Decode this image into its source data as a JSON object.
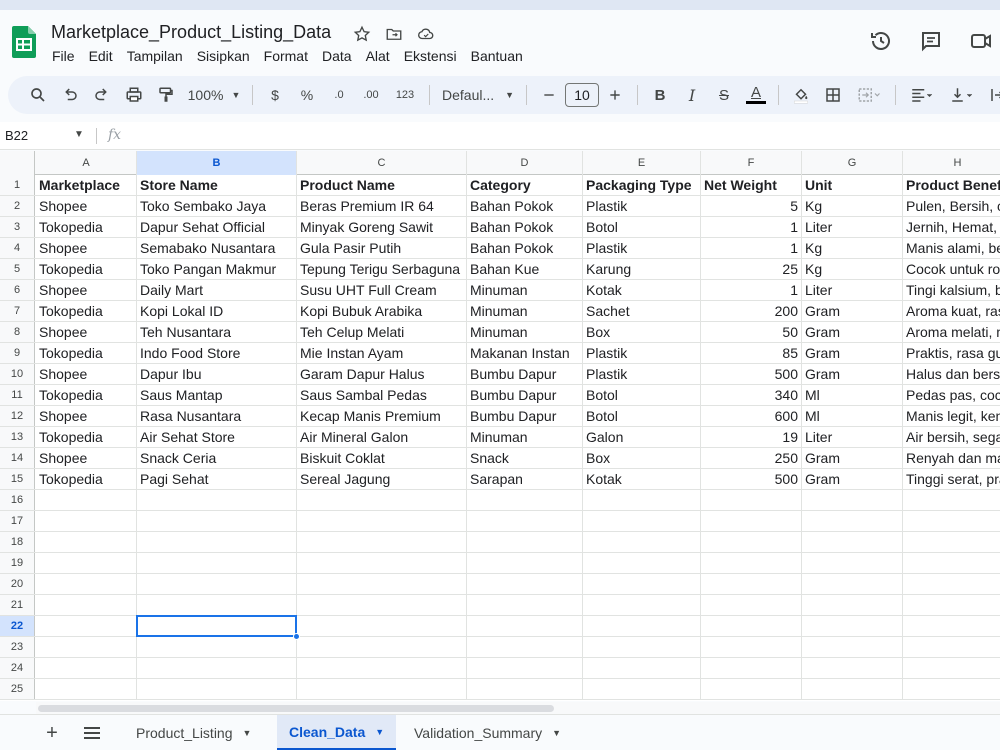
{
  "doc": {
    "title": "Marketplace_Product_Listing_Data"
  },
  "menu": [
    "File",
    "Edit",
    "Tampilan",
    "Sisipkan",
    "Format",
    "Data",
    "Alat",
    "Ekstensi",
    "Bantuan"
  ],
  "toolbar": {
    "zoom": "100%",
    "currency": "$",
    "percent": "%",
    "dec_decrease": ".0",
    "dec_increase": ".00",
    "format_123": "123",
    "font": "Defaul...",
    "font_size": "10",
    "bold": "B",
    "italic": "I",
    "strike": "S",
    "text_color": "A"
  },
  "formula_bar": {
    "cell_ref": "B22",
    "fx": "fx",
    "value": ""
  },
  "columns": [
    "A",
    "B",
    "C",
    "D",
    "E",
    "F",
    "G",
    "H"
  ],
  "selected": {
    "col": "B",
    "row": 22
  },
  "rows": [
    [
      "Marketplace",
      "Store Name",
      "Product Name",
      "Category",
      "Packaging Type",
      "Net Weight",
      "Unit",
      "Product Benefi"
    ],
    [
      "Shopee",
      "Toko Sembako Jaya",
      "Beras Premium IR 64",
      "Bahan Pokok",
      "Plastik",
      "5",
      "Kg",
      "Pulen, Bersih, c"
    ],
    [
      "Tokopedia",
      "Dapur Sehat Official",
      "Minyak Goreng Sawit",
      "Bahan Pokok",
      "Botol",
      "1",
      "Liter",
      "Jernih, Hemat, c"
    ],
    [
      "Shopee",
      "Semabako Nusantara",
      "Gula Pasir Putih",
      "Bahan Pokok",
      "Plastik",
      "1",
      "Kg",
      "Manis alami, be"
    ],
    [
      "Tokopedia",
      "Toko Pangan Makmur",
      "Tepung Terigu Serbaguna",
      "Bahan Kue",
      "Karung",
      "25",
      "Kg",
      "Cocok untuk rot"
    ],
    [
      "Shopee",
      "Daily Mart",
      "Susu UHT Full Cream",
      "Minuman",
      "Kotak",
      "1",
      "Liter",
      "Tingi kalsium, ba"
    ],
    [
      "Tokopedia",
      "Kopi Lokal ID",
      "Kopi Bubuk Arabika",
      "Minuman",
      "Sachet",
      "200",
      "Gram",
      "Aroma kuat, ras"
    ],
    [
      "Shopee",
      "Teh Nusantara",
      "Teh Celup Melati",
      "Minuman",
      "Box",
      "50",
      "Gram",
      "Aroma melati, m"
    ],
    [
      "Tokopedia",
      "Indo Food Store",
      "Mie Instan Ayam",
      "Makanan Instan",
      "Plastik",
      "85",
      "Gram",
      "Praktis, rasa gu"
    ],
    [
      "Shopee",
      "Dapur Ibu",
      "Garam Dapur Halus",
      "Bumbu Dapur",
      "Plastik",
      "500",
      "Gram",
      "Halus dan bersil"
    ],
    [
      "Tokopedia",
      "Saus Mantap",
      "Saus Sambal Pedas",
      "Bumbu Dapur",
      "Botol",
      "340",
      "Ml",
      "Pedas pas, coco"
    ],
    [
      "Shopee",
      "Rasa Nusantara",
      "Kecap Manis Premium",
      "Bumbu Dapur",
      "Botol",
      "600",
      "Ml",
      "Manis legit, ken"
    ],
    [
      "Tokopedia",
      "Air Sehat Store",
      "Air Mineral Galon",
      "Minuman",
      "Galon",
      "19",
      "Liter",
      "Air bersih, segar"
    ],
    [
      "Shopee",
      "Snack Ceria",
      "Biskuit Coklat",
      "Snack",
      "Box",
      "250",
      "Gram",
      "Renyah dan ma"
    ],
    [
      "Tokopedia",
      "Pagi Sehat",
      "Sereal Jagung",
      "Sarapan",
      "Kotak",
      "500",
      "Gram",
      "Tinggi serat, pra"
    ]
  ],
  "total_rows": 25,
  "sheet_tabs": [
    {
      "label": "Product_Listing",
      "active": false
    },
    {
      "label": "Clean_Data",
      "active": true
    },
    {
      "label": "Validation_Summary",
      "active": false
    }
  ],
  "colors": {
    "accent": "#0b57d0",
    "selection": "#1a73e8",
    "sheets_green": "#0f9d58"
  }
}
